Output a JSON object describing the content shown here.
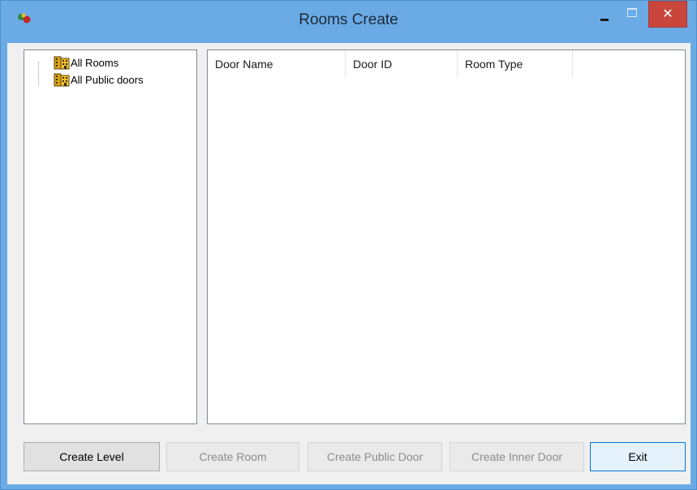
{
  "window": {
    "title": "Rooms Create",
    "close_glyph": "✕",
    "accent_color": "#6aabe6",
    "close_color": "#c9463d"
  },
  "tree": {
    "items": [
      {
        "label": "All Rooms",
        "icon": "building-icon"
      },
      {
        "label": "All Public doors",
        "icon": "building-icon"
      }
    ]
  },
  "list": {
    "columns": [
      "Door Name",
      "Door ID",
      "Room Type",
      ""
    ],
    "rows": []
  },
  "buttons": {
    "create_level": "Create Level",
    "create_room": "Create Room",
    "create_public_door": "Create Public Door",
    "create_inner_door": "Create Inner Door",
    "exit": "Exit"
  }
}
